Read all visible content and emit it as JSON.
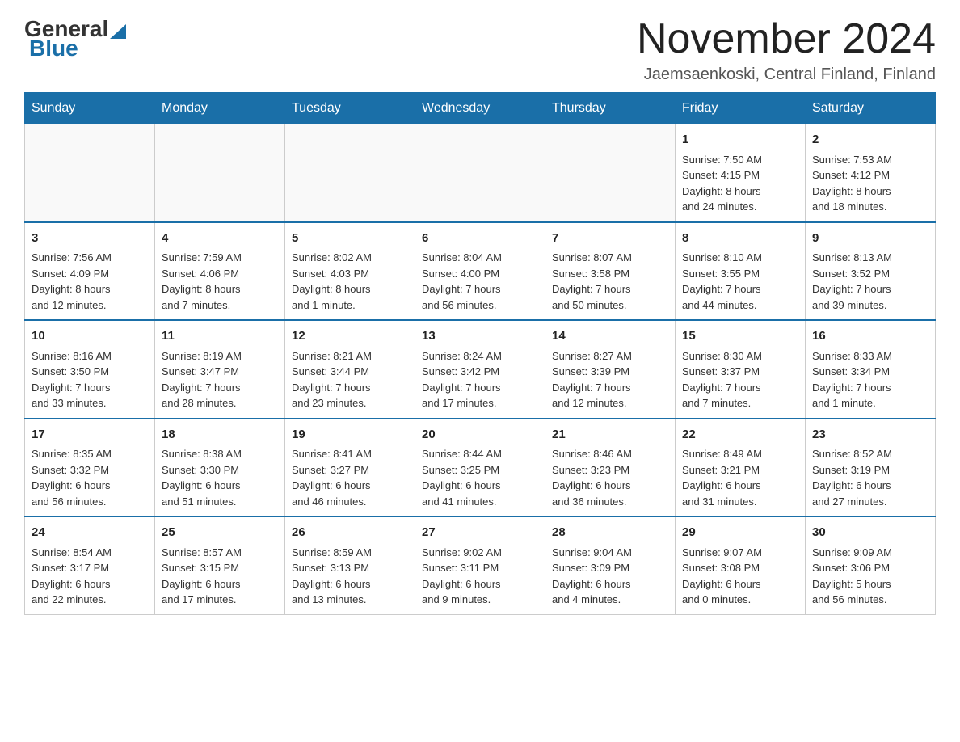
{
  "header": {
    "logo": {
      "general_text": "General",
      "blue_text": "Blue"
    },
    "title": "November 2024",
    "subtitle": "Jaemsaenkoski, Central Finland, Finland"
  },
  "calendar": {
    "days_of_week": [
      "Sunday",
      "Monday",
      "Tuesday",
      "Wednesday",
      "Thursday",
      "Friday",
      "Saturday"
    ],
    "weeks": [
      {
        "days": [
          {
            "num": "",
            "info": ""
          },
          {
            "num": "",
            "info": ""
          },
          {
            "num": "",
            "info": ""
          },
          {
            "num": "",
            "info": ""
          },
          {
            "num": "",
            "info": ""
          },
          {
            "num": "1",
            "info": "Sunrise: 7:50 AM\nSunset: 4:15 PM\nDaylight: 8 hours\nand 24 minutes."
          },
          {
            "num": "2",
            "info": "Sunrise: 7:53 AM\nSunset: 4:12 PM\nDaylight: 8 hours\nand 18 minutes."
          }
        ]
      },
      {
        "days": [
          {
            "num": "3",
            "info": "Sunrise: 7:56 AM\nSunset: 4:09 PM\nDaylight: 8 hours\nand 12 minutes."
          },
          {
            "num": "4",
            "info": "Sunrise: 7:59 AM\nSunset: 4:06 PM\nDaylight: 8 hours\nand 7 minutes."
          },
          {
            "num": "5",
            "info": "Sunrise: 8:02 AM\nSunset: 4:03 PM\nDaylight: 8 hours\nand 1 minute."
          },
          {
            "num": "6",
            "info": "Sunrise: 8:04 AM\nSunset: 4:00 PM\nDaylight: 7 hours\nand 56 minutes."
          },
          {
            "num": "7",
            "info": "Sunrise: 8:07 AM\nSunset: 3:58 PM\nDaylight: 7 hours\nand 50 minutes."
          },
          {
            "num": "8",
            "info": "Sunrise: 8:10 AM\nSunset: 3:55 PM\nDaylight: 7 hours\nand 44 minutes."
          },
          {
            "num": "9",
            "info": "Sunrise: 8:13 AM\nSunset: 3:52 PM\nDaylight: 7 hours\nand 39 minutes."
          }
        ]
      },
      {
        "days": [
          {
            "num": "10",
            "info": "Sunrise: 8:16 AM\nSunset: 3:50 PM\nDaylight: 7 hours\nand 33 minutes."
          },
          {
            "num": "11",
            "info": "Sunrise: 8:19 AM\nSunset: 3:47 PM\nDaylight: 7 hours\nand 28 minutes."
          },
          {
            "num": "12",
            "info": "Sunrise: 8:21 AM\nSunset: 3:44 PM\nDaylight: 7 hours\nand 23 minutes."
          },
          {
            "num": "13",
            "info": "Sunrise: 8:24 AM\nSunset: 3:42 PM\nDaylight: 7 hours\nand 17 minutes."
          },
          {
            "num": "14",
            "info": "Sunrise: 8:27 AM\nSunset: 3:39 PM\nDaylight: 7 hours\nand 12 minutes."
          },
          {
            "num": "15",
            "info": "Sunrise: 8:30 AM\nSunset: 3:37 PM\nDaylight: 7 hours\nand 7 minutes."
          },
          {
            "num": "16",
            "info": "Sunrise: 8:33 AM\nSunset: 3:34 PM\nDaylight: 7 hours\nand 1 minute."
          }
        ]
      },
      {
        "days": [
          {
            "num": "17",
            "info": "Sunrise: 8:35 AM\nSunset: 3:32 PM\nDaylight: 6 hours\nand 56 minutes."
          },
          {
            "num": "18",
            "info": "Sunrise: 8:38 AM\nSunset: 3:30 PM\nDaylight: 6 hours\nand 51 minutes."
          },
          {
            "num": "19",
            "info": "Sunrise: 8:41 AM\nSunset: 3:27 PM\nDaylight: 6 hours\nand 46 minutes."
          },
          {
            "num": "20",
            "info": "Sunrise: 8:44 AM\nSunset: 3:25 PM\nDaylight: 6 hours\nand 41 minutes."
          },
          {
            "num": "21",
            "info": "Sunrise: 8:46 AM\nSunset: 3:23 PM\nDaylight: 6 hours\nand 36 minutes."
          },
          {
            "num": "22",
            "info": "Sunrise: 8:49 AM\nSunset: 3:21 PM\nDaylight: 6 hours\nand 31 minutes."
          },
          {
            "num": "23",
            "info": "Sunrise: 8:52 AM\nSunset: 3:19 PM\nDaylight: 6 hours\nand 27 minutes."
          }
        ]
      },
      {
        "days": [
          {
            "num": "24",
            "info": "Sunrise: 8:54 AM\nSunset: 3:17 PM\nDaylight: 6 hours\nand 22 minutes."
          },
          {
            "num": "25",
            "info": "Sunrise: 8:57 AM\nSunset: 3:15 PM\nDaylight: 6 hours\nand 17 minutes."
          },
          {
            "num": "26",
            "info": "Sunrise: 8:59 AM\nSunset: 3:13 PM\nDaylight: 6 hours\nand 13 minutes."
          },
          {
            "num": "27",
            "info": "Sunrise: 9:02 AM\nSunset: 3:11 PM\nDaylight: 6 hours\nand 9 minutes."
          },
          {
            "num": "28",
            "info": "Sunrise: 9:04 AM\nSunset: 3:09 PM\nDaylight: 6 hours\nand 4 minutes."
          },
          {
            "num": "29",
            "info": "Sunrise: 9:07 AM\nSunset: 3:08 PM\nDaylight: 6 hours\nand 0 minutes."
          },
          {
            "num": "30",
            "info": "Sunrise: 9:09 AM\nSunset: 3:06 PM\nDaylight: 5 hours\nand 56 minutes."
          }
        ]
      }
    ]
  }
}
